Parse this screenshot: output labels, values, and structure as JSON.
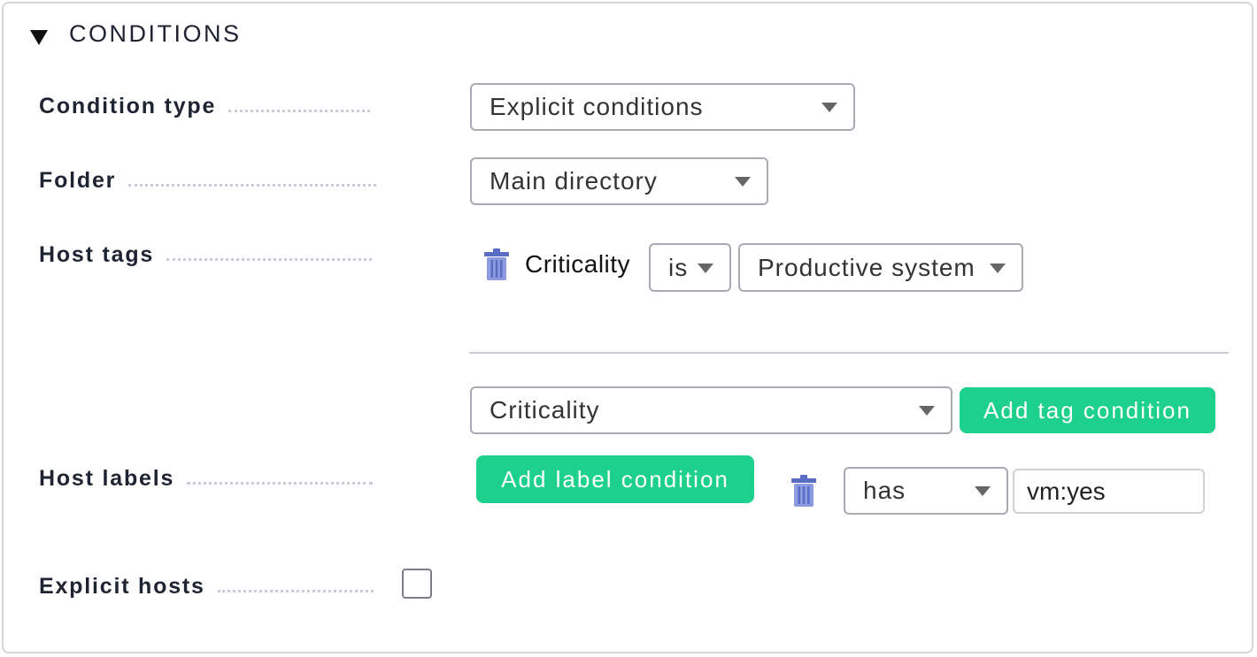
{
  "section": {
    "title": "CONDITIONS"
  },
  "rows": {
    "condition_type": {
      "label": "Condition type",
      "value": "Explicit conditions"
    },
    "folder": {
      "label": "Folder",
      "value": "Main directory"
    },
    "host_tags": {
      "label": "Host tags",
      "tag_name": "Criticality",
      "operator": "is",
      "tag_value": "Productive system",
      "new_tag_select": "Criticality",
      "add_button": "Add tag condition"
    },
    "host_labels": {
      "label": "Host labels",
      "add_button": "Add label condition",
      "operator": "has",
      "label_value": "vm:yes"
    },
    "explicit_hosts": {
      "label": "Explicit hosts",
      "checked": false
    }
  },
  "colors": {
    "accent_button": "#1dd08b",
    "trash_icon": "#6b7ccc",
    "text": "#1f2433"
  },
  "icons": {
    "collapse": "triangle-down-icon",
    "delete": "trash-icon",
    "dropdown": "chevron-down-icon"
  }
}
